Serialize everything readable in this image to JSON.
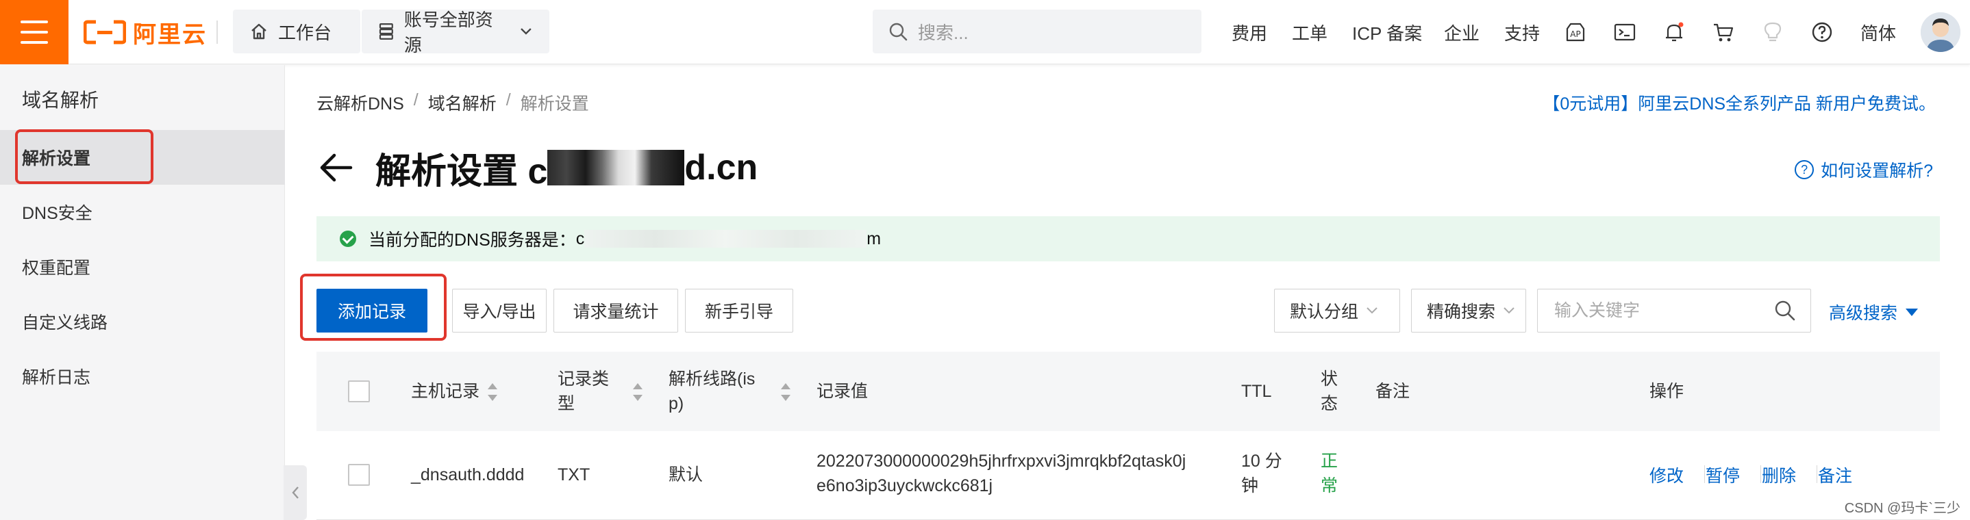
{
  "header": {
    "logo_text": "阿里云",
    "workbench_label": "工作台",
    "resource_scope_label": "账号全部资源",
    "search_placeholder": "搜索...",
    "nav": [
      "费用",
      "工单",
      "ICP 备案",
      "企业",
      "支持"
    ],
    "language_label": "简体",
    "icons": [
      "app-icon",
      "terminal-icon",
      "bell-icon",
      "cart-icon",
      "lightbulb-icon",
      "help-icon"
    ]
  },
  "sidebar": {
    "title": "域名解析",
    "items": [
      {
        "label": "解析设置",
        "active": true
      },
      {
        "label": "DNS安全",
        "active": false
      },
      {
        "label": "权重配置",
        "active": false
      },
      {
        "label": "自定义线路",
        "active": false
      },
      {
        "label": "解析日志",
        "active": false
      }
    ]
  },
  "breadcrumb": [
    "云解析DNS",
    "域名解析",
    "解析设置"
  ],
  "promo_text": "【0元试用】阿里云DNS全系列产品 新用户免费试。",
  "page": {
    "title_prefix": "解析设置 c",
    "title_suffix": "d.cn",
    "help_link": "如何设置解析?"
  },
  "dns_banner": {
    "label": "当前分配的DNS服务器是：",
    "value_start": "c",
    "value_end": "m"
  },
  "toolbar": {
    "add_record": "添加记录",
    "import_export": "导入/导出",
    "request_stats": "请求量统计",
    "beginner_guide": "新手引导",
    "group_select": "默认分组",
    "match_select": "精确搜索",
    "keyword_placeholder": "输入关键字",
    "advanced_search": "高级搜索"
  },
  "table": {
    "columns": {
      "host": "主机记录",
      "type_l1": "记录类",
      "type_l2": "型",
      "line_l1": "解析线路(is",
      "line_l2": "p)",
      "value": "记录值",
      "ttl": "TTL",
      "status_l1": "状",
      "status_l2": "态",
      "remark": "备注",
      "actions": "操作"
    },
    "rows": [
      {
        "host": "_dnsauth.dddd",
        "type": "TXT",
        "line": "默认",
        "value_l1": "2022073000000029h5jhrfrxpxvi3jmrqkbf2qtask0j",
        "value_l2": "e6no3ip3uyckwckc681j",
        "ttl_l1": "10 分",
        "ttl_l2": "钟",
        "status_l1": "正",
        "status_l2": "常",
        "actions": [
          "修改",
          "暂停",
          "删除",
          "备注"
        ]
      }
    ]
  },
  "watermark": "CSDN @玛卡`三少",
  "colors": {
    "brand_orange": "#ff6a00",
    "primary_blue": "#0064c8",
    "status_green": "#27a24a",
    "annotation_red": "#e0362d"
  }
}
